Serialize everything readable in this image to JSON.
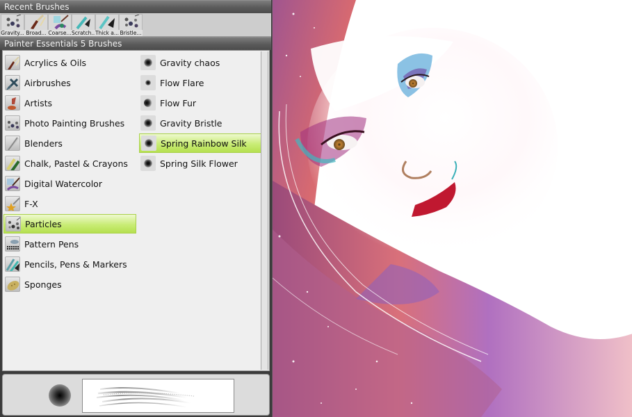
{
  "recent_brushes": {
    "title": "Recent Brushes",
    "items": [
      {
        "label": "Gravity...",
        "icon": "particles-icon"
      },
      {
        "label": "Broad...",
        "icon": "broad-brush-icon"
      },
      {
        "label": "Coarse...",
        "icon": "coarse-brush-icon"
      },
      {
        "label": "Scratch...",
        "icon": "scratch-pen-icon"
      },
      {
        "label": "Thick a...",
        "icon": "thick-pen-icon"
      },
      {
        "label": "Bristle...",
        "icon": "particles-icon"
      }
    ]
  },
  "library": {
    "title": "Painter Essentials 5 Brushes",
    "categories": [
      {
        "label": "Acrylics & Oils",
        "icon": "acrylics-oils-icon",
        "selected": false
      },
      {
        "label": "Airbrushes",
        "icon": "airbrush-icon",
        "selected": false
      },
      {
        "label": "Artists",
        "icon": "artists-icon",
        "selected": false
      },
      {
        "label": "Photo Painting Brushes",
        "icon": "photo-painting-icon",
        "selected": false
      },
      {
        "label": "Blenders",
        "icon": "blenders-icon",
        "selected": false
      },
      {
        "label": "Chalk, Pastel & Crayons",
        "icon": "chalk-pastel-icon",
        "selected": false
      },
      {
        "label": "Digital Watercolor",
        "icon": "digital-watercolor-icon",
        "selected": false
      },
      {
        "label": "F-X",
        "icon": "fx-star-icon",
        "selected": false
      },
      {
        "label": "Particles",
        "icon": "particles-icon",
        "selected": true
      },
      {
        "label": "Pattern Pens",
        "icon": "pattern-pens-icon",
        "selected": false
      },
      {
        "label": "Pencils, Pens & Markers",
        "icon": "pencils-pens-icon",
        "selected": false
      },
      {
        "label": "Sponges",
        "icon": "sponge-icon",
        "selected": false
      }
    ],
    "variants": [
      {
        "label": "Gravity chaos",
        "icon": "brush-dab-icon",
        "selected": false
      },
      {
        "label": "Flow Flare",
        "icon": "brush-dab-icon",
        "selected": false
      },
      {
        "label": "Flow Fur",
        "icon": "brush-dab-icon",
        "selected": false
      },
      {
        "label": "Gravity Bristle",
        "icon": "brush-dab-icon",
        "selected": false
      },
      {
        "label": "Spring Rainbow Silk",
        "icon": "brush-dab-icon",
        "selected": true
      },
      {
        "label": "Spring Silk Flower",
        "icon": "brush-dab-icon",
        "selected": false
      }
    ]
  },
  "preview": {
    "dab_icon": "brush-dab-preview-icon",
    "stroke_icon": "brush-stroke-preview-icon"
  },
  "colors": {
    "selection_green": "#c9ec76",
    "header_gray": "#5a5a5a",
    "list_bg": "#efefef"
  },
  "canvas": {
    "content": "watercolor portrait painting of a woman with colorful eye makeup and red lips"
  }
}
